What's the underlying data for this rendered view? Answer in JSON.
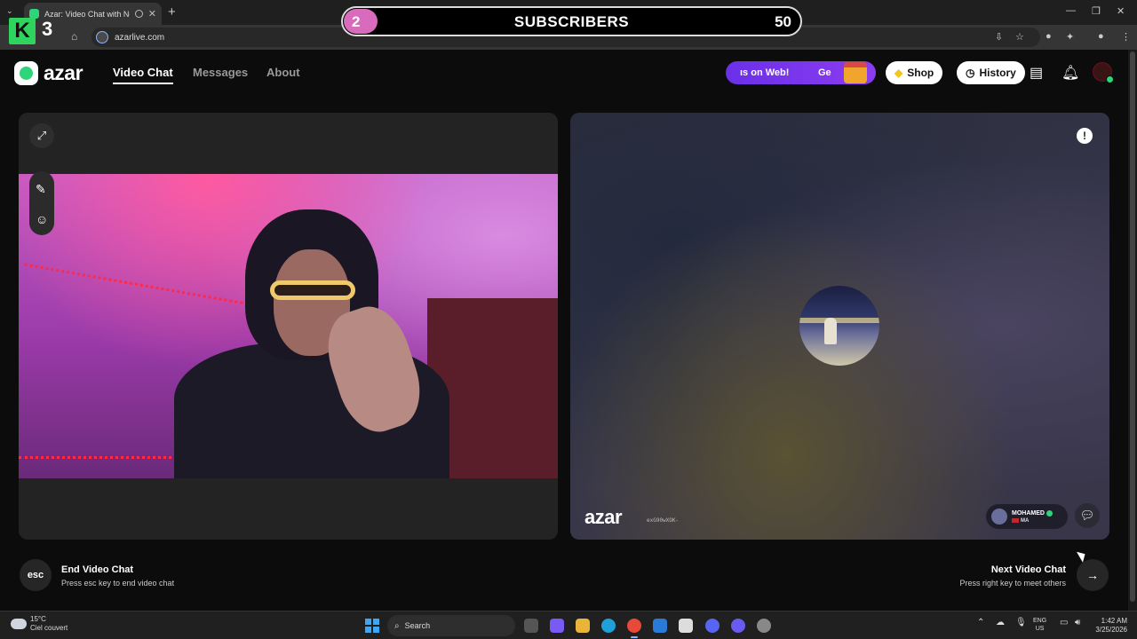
{
  "browser": {
    "tab_title": "Azar: Video Chat with New",
    "url": "azarlive.com"
  },
  "overlay": {
    "k_count": "3",
    "subscribers_current": "2",
    "subscribers_label": "SUBSCRIBERS",
    "subscribers_goal": "50",
    "progress_fraction": 0.04
  },
  "header": {
    "logo_text": "azar",
    "nav": [
      {
        "label": "Video Chat",
        "active": true
      },
      {
        "label": "Messages",
        "active": false
      },
      {
        "label": "About",
        "active": false
      }
    ],
    "promo_text": "ıs on Web!",
    "promo_tail": "Ge",
    "shop_label": "Shop",
    "history_label": "History"
  },
  "peer": {
    "watermark": "azar",
    "watermark_id": "exG90wXOK-",
    "name": "MOHAMED",
    "country": "MA"
  },
  "controls": {
    "esc_label": "esc",
    "end_title": "End Video Chat",
    "end_sub": "Press esc key to end video chat",
    "next_title": "Next Video Chat",
    "next_sub": "Press right key to meet others"
  },
  "taskbar": {
    "temperature": "15°C",
    "weather": "Ciel couvert",
    "search_label": "Search",
    "lang_top": "ENG",
    "lang_bottom": "US",
    "time": "1:42 AM",
    "date": "3/25/2026"
  },
  "colors": {
    "accent_green": "#2ed47a",
    "promo_purple": "#7b35ec",
    "progress_pink": "#d86bbb"
  }
}
